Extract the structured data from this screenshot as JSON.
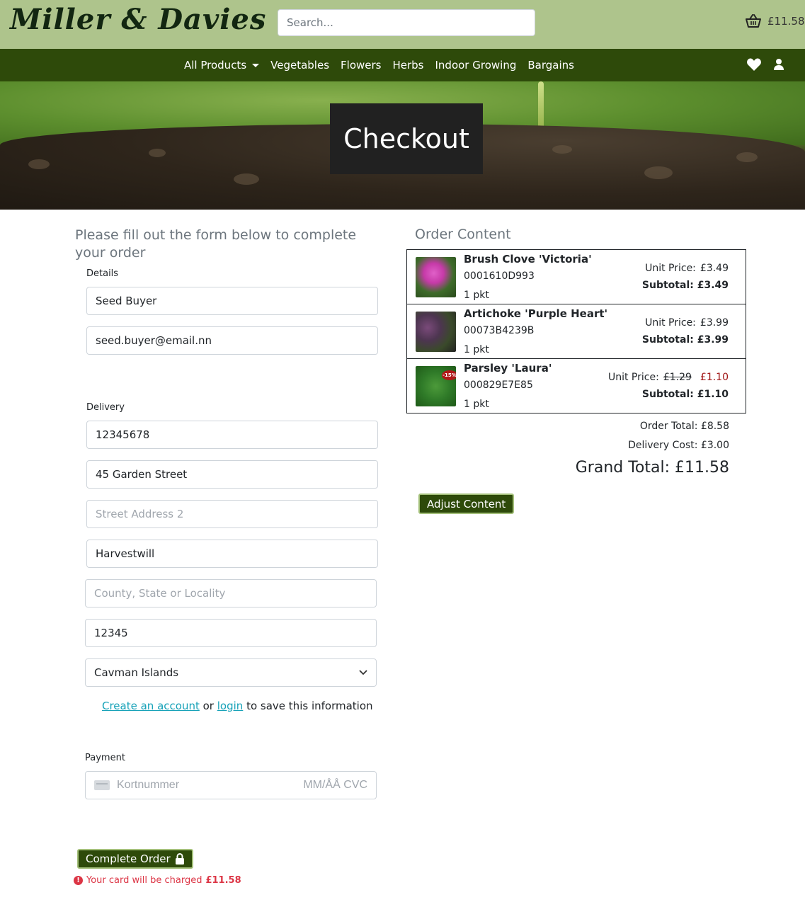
{
  "header": {
    "brand": "Miller & Davies",
    "search_placeholder": "Search...",
    "basket_total": "£11.58"
  },
  "nav": {
    "items": [
      "All Products",
      "Vegetables",
      "Flowers",
      "Herbs",
      "Indoor Growing",
      "Bargains"
    ]
  },
  "hero": {
    "title": "Checkout"
  },
  "form": {
    "intro": "Please fill out the form below to complete your order",
    "details_legend": "Details",
    "full_name": "Seed Buyer",
    "email": "seed.buyer@email.nn",
    "delivery_legend": "Delivery",
    "phone": "12345678",
    "street1": "45 Garden Street",
    "street2_placeholder": "Street Address 2",
    "town": "Harvestwill",
    "county_placeholder": "County, State or Locality",
    "postcode": "12345",
    "country": "Cavman Islands",
    "save_info": {
      "create_account": "Create an account",
      "or": "or",
      "login": "login",
      "suffix": "to save this information"
    },
    "payment_legend": "Payment",
    "card_placeholder": "Kortnummer",
    "card_expiry_cvc": "MM/ÅÅ CVC",
    "complete_button": "Complete Order",
    "charge_note": "Your card will be charged",
    "charge_amount": "£11.58"
  },
  "order": {
    "heading": "Order Content",
    "items": [
      {
        "name": "Brush Clove 'Victoria'",
        "sku": "0001610D993",
        "qty": "1 pkt",
        "unit_label": "Unit Price:",
        "unit_price": "£3.49",
        "subtotal": "Subtotal: £3.49"
      },
      {
        "name": "Artichoke 'Purple Heart'",
        "sku": "00073B4239B",
        "qty": "1 pkt",
        "unit_label": "Unit Price:",
        "unit_price": "£3.99",
        "subtotal": "Subtotal: £3.99"
      },
      {
        "name": "Parsley 'Laura'",
        "sku": "000829E7E85",
        "qty": "1 pkt",
        "unit_label": "Unit Price:",
        "old_price": "£1.29",
        "unit_price": "£1.10",
        "sale_badge": "-15%",
        "subtotal": "Subtotal: £1.10"
      }
    ],
    "order_total": "Order Total: £8.58",
    "delivery_cost": "Delivery Cost: £3.00",
    "grand_total": "Grand Total: £11.58",
    "adjust_button": "Adjust Content"
  },
  "colors": {
    "topbar": "#aec48c",
    "navbar": "#2e4a0a",
    "brand_text": "#122611",
    "link": "#17a2b8",
    "error": "#dc3545"
  }
}
